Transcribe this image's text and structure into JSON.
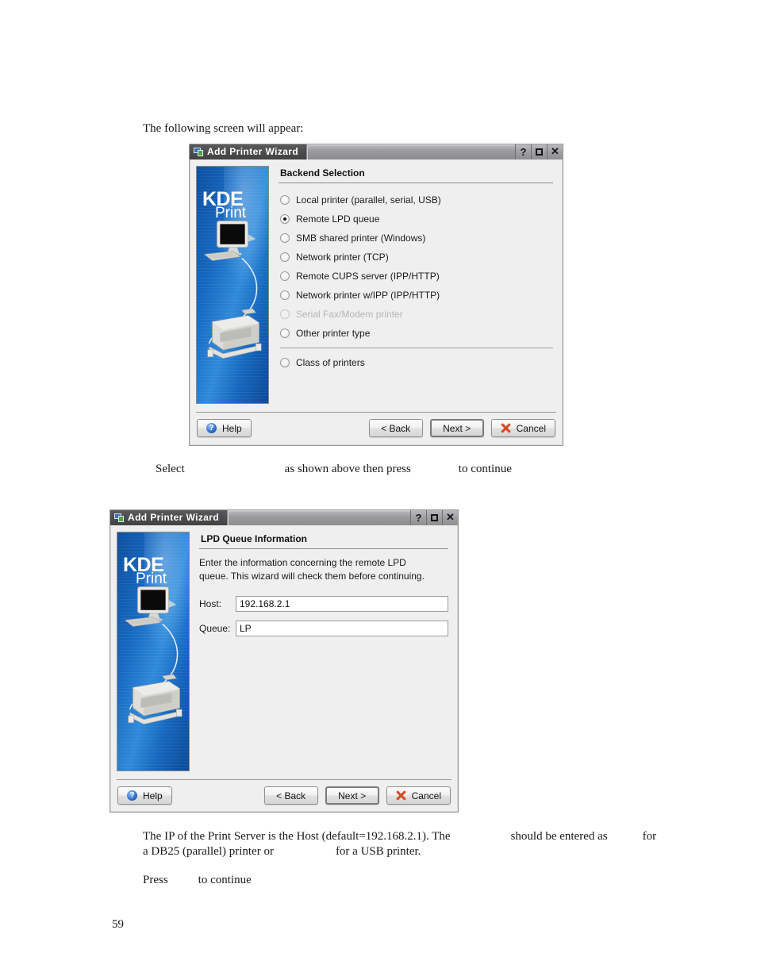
{
  "document": {
    "intro_line": "The following screen will appear:",
    "mid_line_part1": "Select",
    "mid_line_part2": "as shown above then press",
    "mid_line_part3": "to continue",
    "bottom_par_line1_a": "The IP of the Print Server is the Host (default=192.168.2.1). The",
    "bottom_par_line1_b": "should be entered as",
    "bottom_par_line1_c": "for",
    "bottom_par_line2_a": "a DB25 (parallel) printer or",
    "bottom_par_line2_b": "for a USB printer.",
    "press_line_a": "Press",
    "press_line_b": "to continue",
    "page_number": "59"
  },
  "dialog_backend": {
    "title": "Add Printer Wizard",
    "titlebar_buttons": {
      "help": "?",
      "maximize": "maximize-icon",
      "close": "✕"
    },
    "sidebar": {
      "logo_primary": "KDE",
      "logo_secondary": "Print"
    },
    "section_heading": "Backend Selection",
    "options": [
      {
        "label": "Local printer (parallel, serial, USB)",
        "mnemonic": "L",
        "selected": false,
        "disabled": false
      },
      {
        "label": "Remote LPD queue",
        "mnemonic": "R",
        "selected": true,
        "disabled": false
      },
      {
        "label": "SMB shared printer (Windows)",
        "mnemonic": "S",
        "selected": false,
        "disabled": false
      },
      {
        "label": "Network printer (TCP)",
        "mnemonic": "t",
        "selected": false,
        "disabled": false
      },
      {
        "label": "Remote CUPS server (IPP/HTTP)",
        "mnemonic": "m",
        "selected": false,
        "disabled": false
      },
      {
        "label": "Network printer w/IPP (IPP/HTTP)",
        "mnemonic": "I",
        "selected": false,
        "disabled": false
      },
      {
        "label": "Serial Fax/Modem printer",
        "mnemonic": "",
        "selected": false,
        "disabled": true
      },
      {
        "label": "Other printer type",
        "mnemonic": "p",
        "selected": false,
        "disabled": false
      }
    ],
    "class_option": {
      "label": "Class of printers",
      "mnemonic": "a",
      "selected": false,
      "disabled": false
    },
    "buttons": {
      "help": "Help",
      "back": "< Back",
      "next": "Next >",
      "cancel": "Cancel"
    }
  },
  "dialog_lpd": {
    "title": "Add Printer Wizard",
    "titlebar_buttons": {
      "help": "?",
      "maximize": "maximize-icon",
      "close": "✕"
    },
    "sidebar": {
      "logo_primary": "KDE",
      "logo_secondary": "Print"
    },
    "section_heading": "LPD Queue Information",
    "description": "Enter the information concerning the remote LPD queue. This wizard will check them before continuing.",
    "fields": [
      {
        "label": "Host:",
        "value": "192.168.2.1"
      },
      {
        "label": "Queue:",
        "value": "LP"
      }
    ],
    "buttons": {
      "help": "Help",
      "back": "< Back",
      "next": "Next >",
      "cancel": "Cancel"
    }
  },
  "colors": {
    "dialog_background": "#efefef",
    "titlebar_dark": "#4b4b4d",
    "sidebar_blue": "#1668c0",
    "accent_help_blue": "#1c62c4",
    "accent_cancel_red": "#d64a21"
  }
}
